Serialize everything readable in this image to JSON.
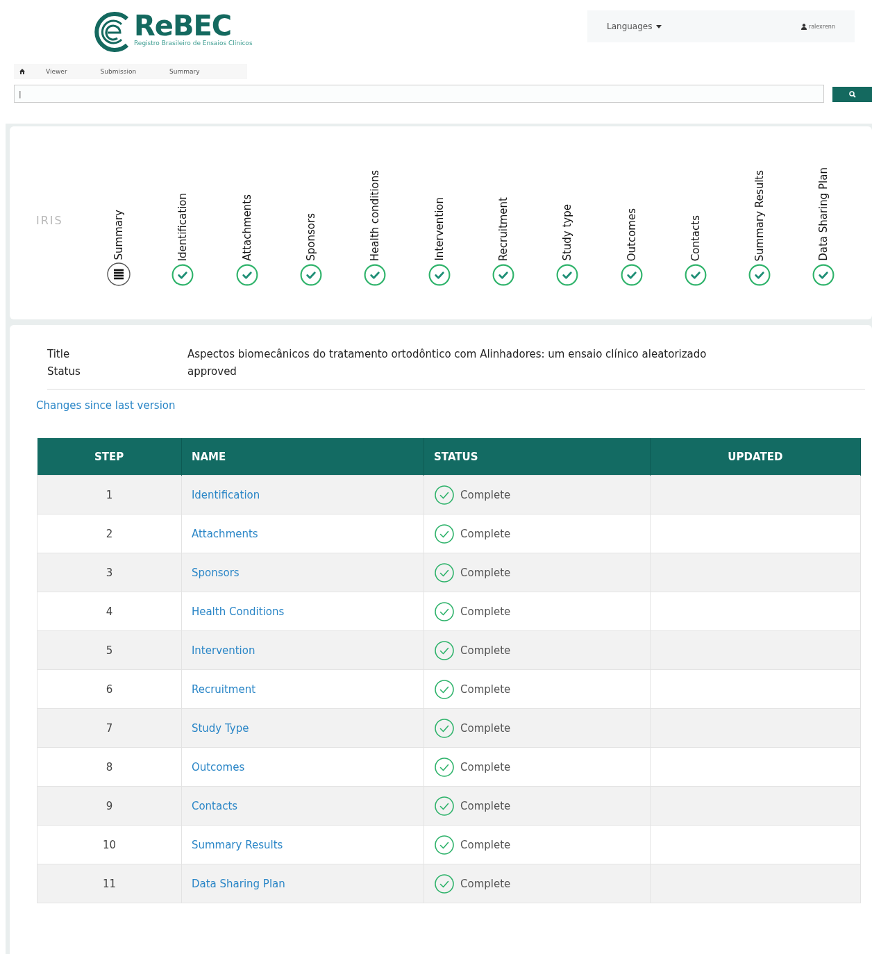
{
  "logo": {
    "name": "ReBEC",
    "subtitle": "Registro Brasileiro de Ensaios Clínicos"
  },
  "topnav": {
    "languages": "Languages",
    "user": "ralexrenn"
  },
  "breadcrumb": [
    "Viewer",
    "Submission",
    "Summary"
  ],
  "search": {
    "value": "|"
  },
  "steps_panel": {
    "faint_label": "IRIS",
    "steps": [
      {
        "label": "Summary",
        "kind": "summary"
      },
      {
        "label": "Identification",
        "kind": "complete"
      },
      {
        "label": "Attachments",
        "kind": "complete"
      },
      {
        "label": "Sponsors",
        "kind": "complete"
      },
      {
        "label": "Health conditions",
        "kind": "complete"
      },
      {
        "label": "Intervention",
        "kind": "complete"
      },
      {
        "label": "Recruitment",
        "kind": "complete"
      },
      {
        "label": "Study type",
        "kind": "complete"
      },
      {
        "label": "Outcomes",
        "kind": "complete"
      },
      {
        "label": "Contacts",
        "kind": "complete"
      },
      {
        "label": "Summary Results",
        "kind": "complete"
      },
      {
        "label": "Data Sharing Plan",
        "kind": "complete"
      }
    ]
  },
  "info": [
    {
      "label": "Title",
      "value": "Aspectos biomecânicos do tratamento ortodôntico com Alinhadores: um ensaio clínico aleatorizado"
    },
    {
      "label": "Status",
      "value": "approved"
    }
  ],
  "changes_link": "Changes since last version",
  "table": {
    "columns": [
      "STEP",
      "NAME",
      "STATUS",
      "UPDATED"
    ],
    "rows": [
      {
        "step": "1",
        "name": "Identification",
        "status": "Complete"
      },
      {
        "step": "2",
        "name": "Attachments",
        "status": "Complete"
      },
      {
        "step": "3",
        "name": "Sponsors",
        "status": "Complete"
      },
      {
        "step": "4",
        "name": "Health Conditions",
        "status": "Complete"
      },
      {
        "step": "5",
        "name": "Intervention",
        "status": "Complete"
      },
      {
        "step": "6",
        "name": "Recruitment",
        "status": "Complete"
      },
      {
        "step": "7",
        "name": "Study Type",
        "status": "Complete"
      },
      {
        "step": "8",
        "name": "Outcomes",
        "status": "Complete"
      },
      {
        "step": "9",
        "name": "Contacts",
        "status": "Complete"
      },
      {
        "step": "10",
        "name": "Summary Results",
        "status": "Complete"
      },
      {
        "step": "11",
        "name": "Data Sharing Plan",
        "status": "Complete"
      }
    ]
  }
}
